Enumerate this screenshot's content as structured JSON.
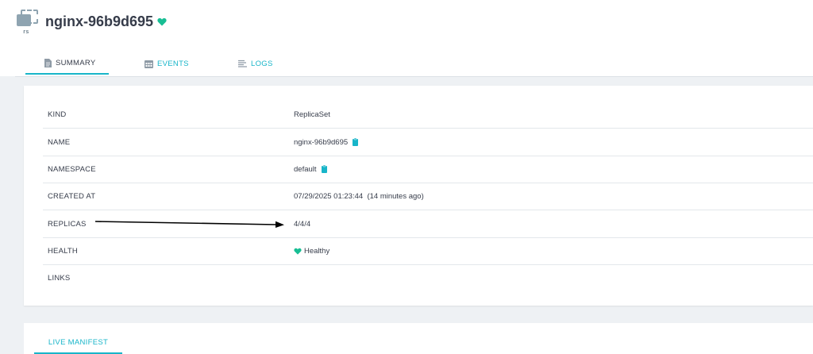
{
  "resource": {
    "icon": "replicaset-icon",
    "icon_label": "rs",
    "name": "nginx-96b9d695",
    "health_icon": "heart-icon",
    "health_color": "#18be94"
  },
  "tabs": [
    {
      "label": "SUMMARY",
      "icon": "file-icon",
      "active": true
    },
    {
      "label": "EVENTS",
      "icon": "calendar-icon",
      "active": false
    },
    {
      "label": "LOGS",
      "icon": "lines-icon",
      "active": false
    }
  ],
  "summary": {
    "rows": [
      {
        "key": "KIND",
        "value": "ReplicaSet"
      },
      {
        "key": "NAME",
        "value": "nginx-96b9d695",
        "copy_icon": "clipboard-icon"
      },
      {
        "key": "NAMESPACE",
        "value": "default",
        "copy_icon": "clipboard-icon"
      },
      {
        "key": "CREATED AT",
        "value": "07/29/2025 01:23:44  (14 minutes ago)"
      },
      {
        "key": "REPLICAS",
        "value": "4/4/4"
      },
      {
        "key": "HEALTH",
        "value": "Healthy",
        "icon": "heart-icon"
      },
      {
        "key": "LINKS",
        "value": ""
      }
    ]
  },
  "annotation": {
    "type": "arrow",
    "from": "REPLICAS",
    "to": "4/4/4",
    "color": "#000000"
  },
  "manifest_tab": {
    "label": "LIVE MANIFEST"
  },
  "colors": {
    "accent": "#18b5c9",
    "healthy": "#18be94",
    "text": "#363c4a",
    "background": "#eef1f4"
  }
}
